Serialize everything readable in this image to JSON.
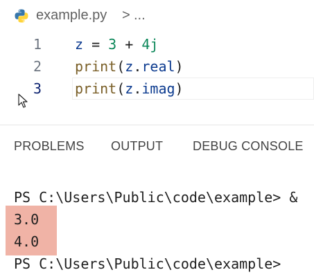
{
  "breadcrumb": {
    "file_name": "example.py",
    "separator": ">",
    "ellipsis": "..."
  },
  "editor": {
    "lines": [
      {
        "number": "1",
        "code": "z = 3 + 4j"
      },
      {
        "number": "2",
        "code": "print(z.real)"
      },
      {
        "number": "3",
        "code": "print(z.imag)"
      }
    ]
  },
  "panel": {
    "tabs": [
      {
        "label": "PROBLEMS"
      },
      {
        "label": "OUTPUT"
      },
      {
        "label": "DEBUG CONSOLE"
      }
    ]
  },
  "terminal": {
    "prompt_line_1": "PS C:\\Users\\Public\\code\\example> &",
    "output_1": "3.0",
    "output_2": "4.0",
    "prompt_line_2": "PS C:\\Users\\Public\\code\\example>"
  },
  "colors": {
    "highlight": "#f0b3a6",
    "python_blue": "#3776ab",
    "python_yellow": "#ffd43b"
  },
  "icons": {
    "file_icon": "python-icon",
    "pointer": "mouse-cursor-icon"
  }
}
